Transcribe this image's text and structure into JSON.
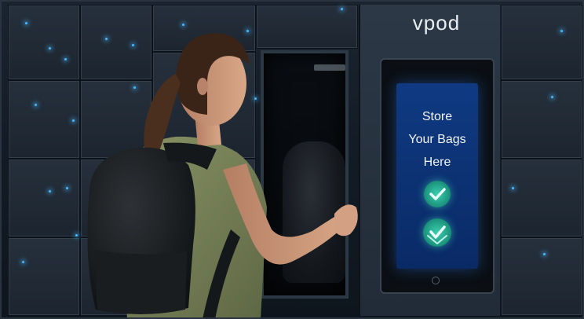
{
  "kiosk": {
    "brand": "vpod",
    "screen_message": "Store\nYour Bags\nHere",
    "led_color": "#4ab8ff",
    "screen_color": "#0f3a82",
    "icons": [
      "check-circle-icon",
      "check-circle-icon"
    ]
  }
}
